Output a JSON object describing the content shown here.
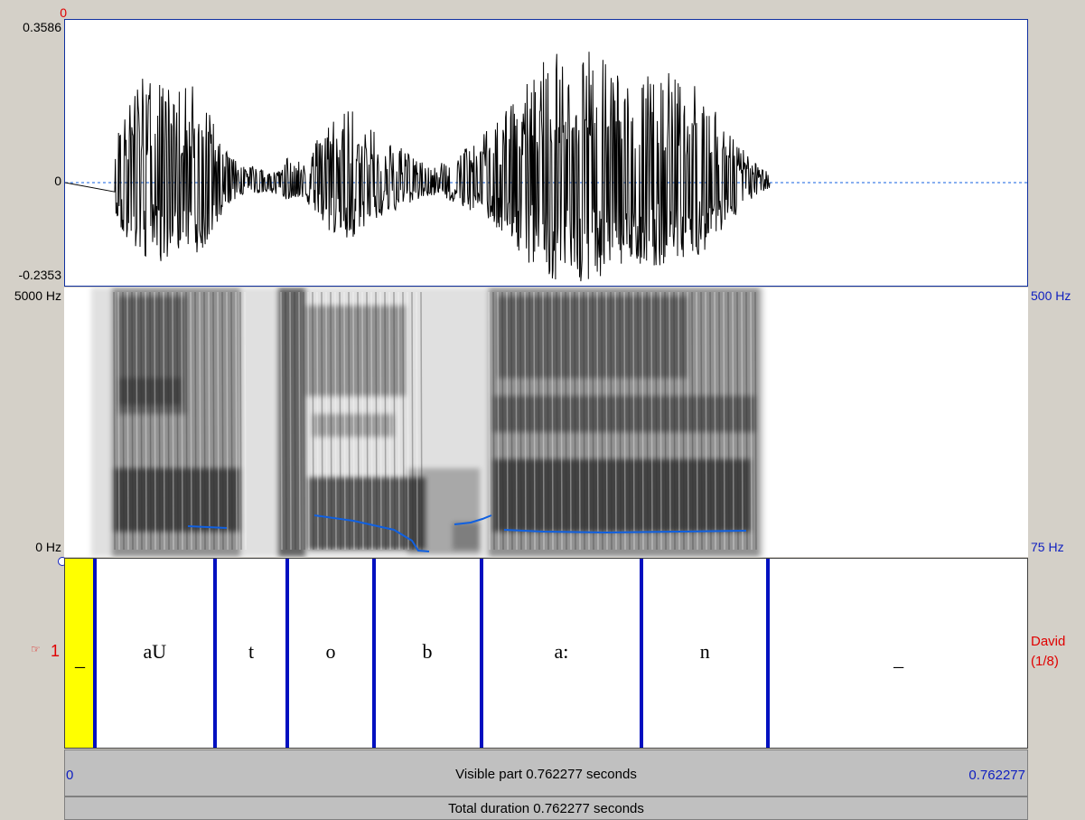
{
  "waveform": {
    "max_label": "0.3586",
    "zero_label": "0",
    "min_label": "-0.2353",
    "cursor_label": "0",
    "colors": {
      "trace": "#000000",
      "zero_line": "#1060e0",
      "border": "#1030a0"
    }
  },
  "spectrogram": {
    "top_freq_label": "5000 Hz",
    "bottom_freq_label": "0 Hz",
    "pitch_top_label": "500 Hz",
    "pitch_bottom_label": "75 Hz",
    "colors": {
      "pitch": "#1060e0"
    }
  },
  "tier": {
    "number_label": "1",
    "name": "David",
    "position": "(1/8)",
    "pointer_icon": "pointing-hand-icon",
    "selected_color": "#ffff00",
    "boundary_color": "#0010c0",
    "segments": [
      {
        "label": "_",
        "start": 0.0,
        "end": 0.0235,
        "selected": true
      },
      {
        "label": "aU",
        "start": 0.0235,
        "end": 0.1185
      },
      {
        "label": "t",
        "start": 0.1185,
        "end": 0.176
      },
      {
        "label": "o",
        "start": 0.176,
        "end": 0.244
      },
      {
        "label": "b",
        "start": 0.244,
        "end": 0.329
      },
      {
        "label": "a:",
        "start": 0.329,
        "end": 0.456
      },
      {
        "label": "n",
        "start": 0.456,
        "end": 0.556
      },
      {
        "label": "_",
        "start": 0.556,
        "end": 0.762277
      }
    ]
  },
  "time_bar": {
    "start_label": "0",
    "end_label": "0.762277",
    "visible_text": "Visible part 0.762277 seconds",
    "total_text": "Total duration 0.762277 seconds"
  }
}
